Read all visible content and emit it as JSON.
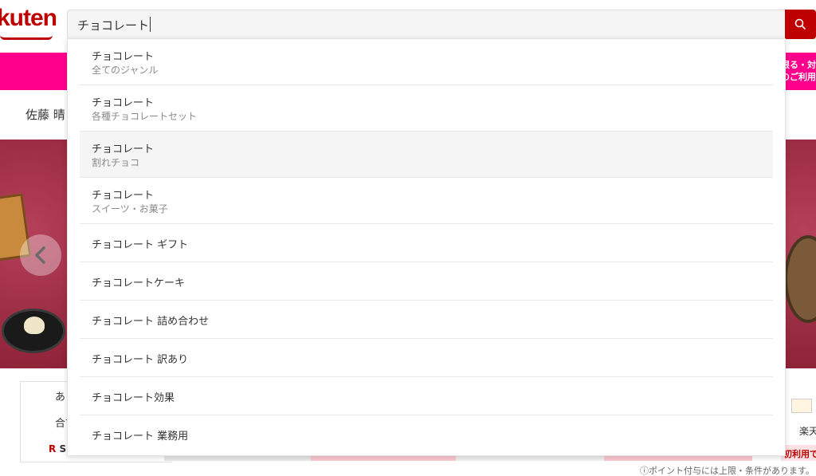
{
  "header": {
    "logo_text": "kuten",
    "search": {
      "value": "チョコレート"
    },
    "search_button_icon": "search-icon"
  },
  "banner": {
    "line1": "限る・対",
    "line2": "のご利用"
  },
  "greeting": "佐藤 晴",
  "hero": {
    "prev_icon": "chevron-left-icon"
  },
  "card": {
    "line1": "あ",
    "line2": "合言",
    "badge_r": "R",
    "badge_text": "SP"
  },
  "right_card": {
    "text": "楽天",
    "red_text": "初利用でS"
  },
  "footnote": "ⓘポイント付与には上限・条件があります。",
  "suggestions": [
    {
      "label": "チョコレート",
      "category": "全てのジャンル"
    },
    {
      "label": "チョコレート",
      "category": "各種チョコレートセット"
    },
    {
      "label": "チョコレート",
      "category": "割れチョコ"
    },
    {
      "label": "チョコレート",
      "category": "スイーツ・お菓子"
    },
    {
      "label": "チョコレート ギフト"
    },
    {
      "label": "チョコレートケーキ"
    },
    {
      "label": "チョコレート 詰め合わせ"
    },
    {
      "label": "チョコレート 訳あり"
    },
    {
      "label": "チョコレート効果"
    },
    {
      "label": "チョコレート 業務用"
    }
  ],
  "colors": {
    "brand_red": "#bf0000",
    "banner_pink": "#ff008c",
    "hero_bg": "#9a2a3f"
  }
}
